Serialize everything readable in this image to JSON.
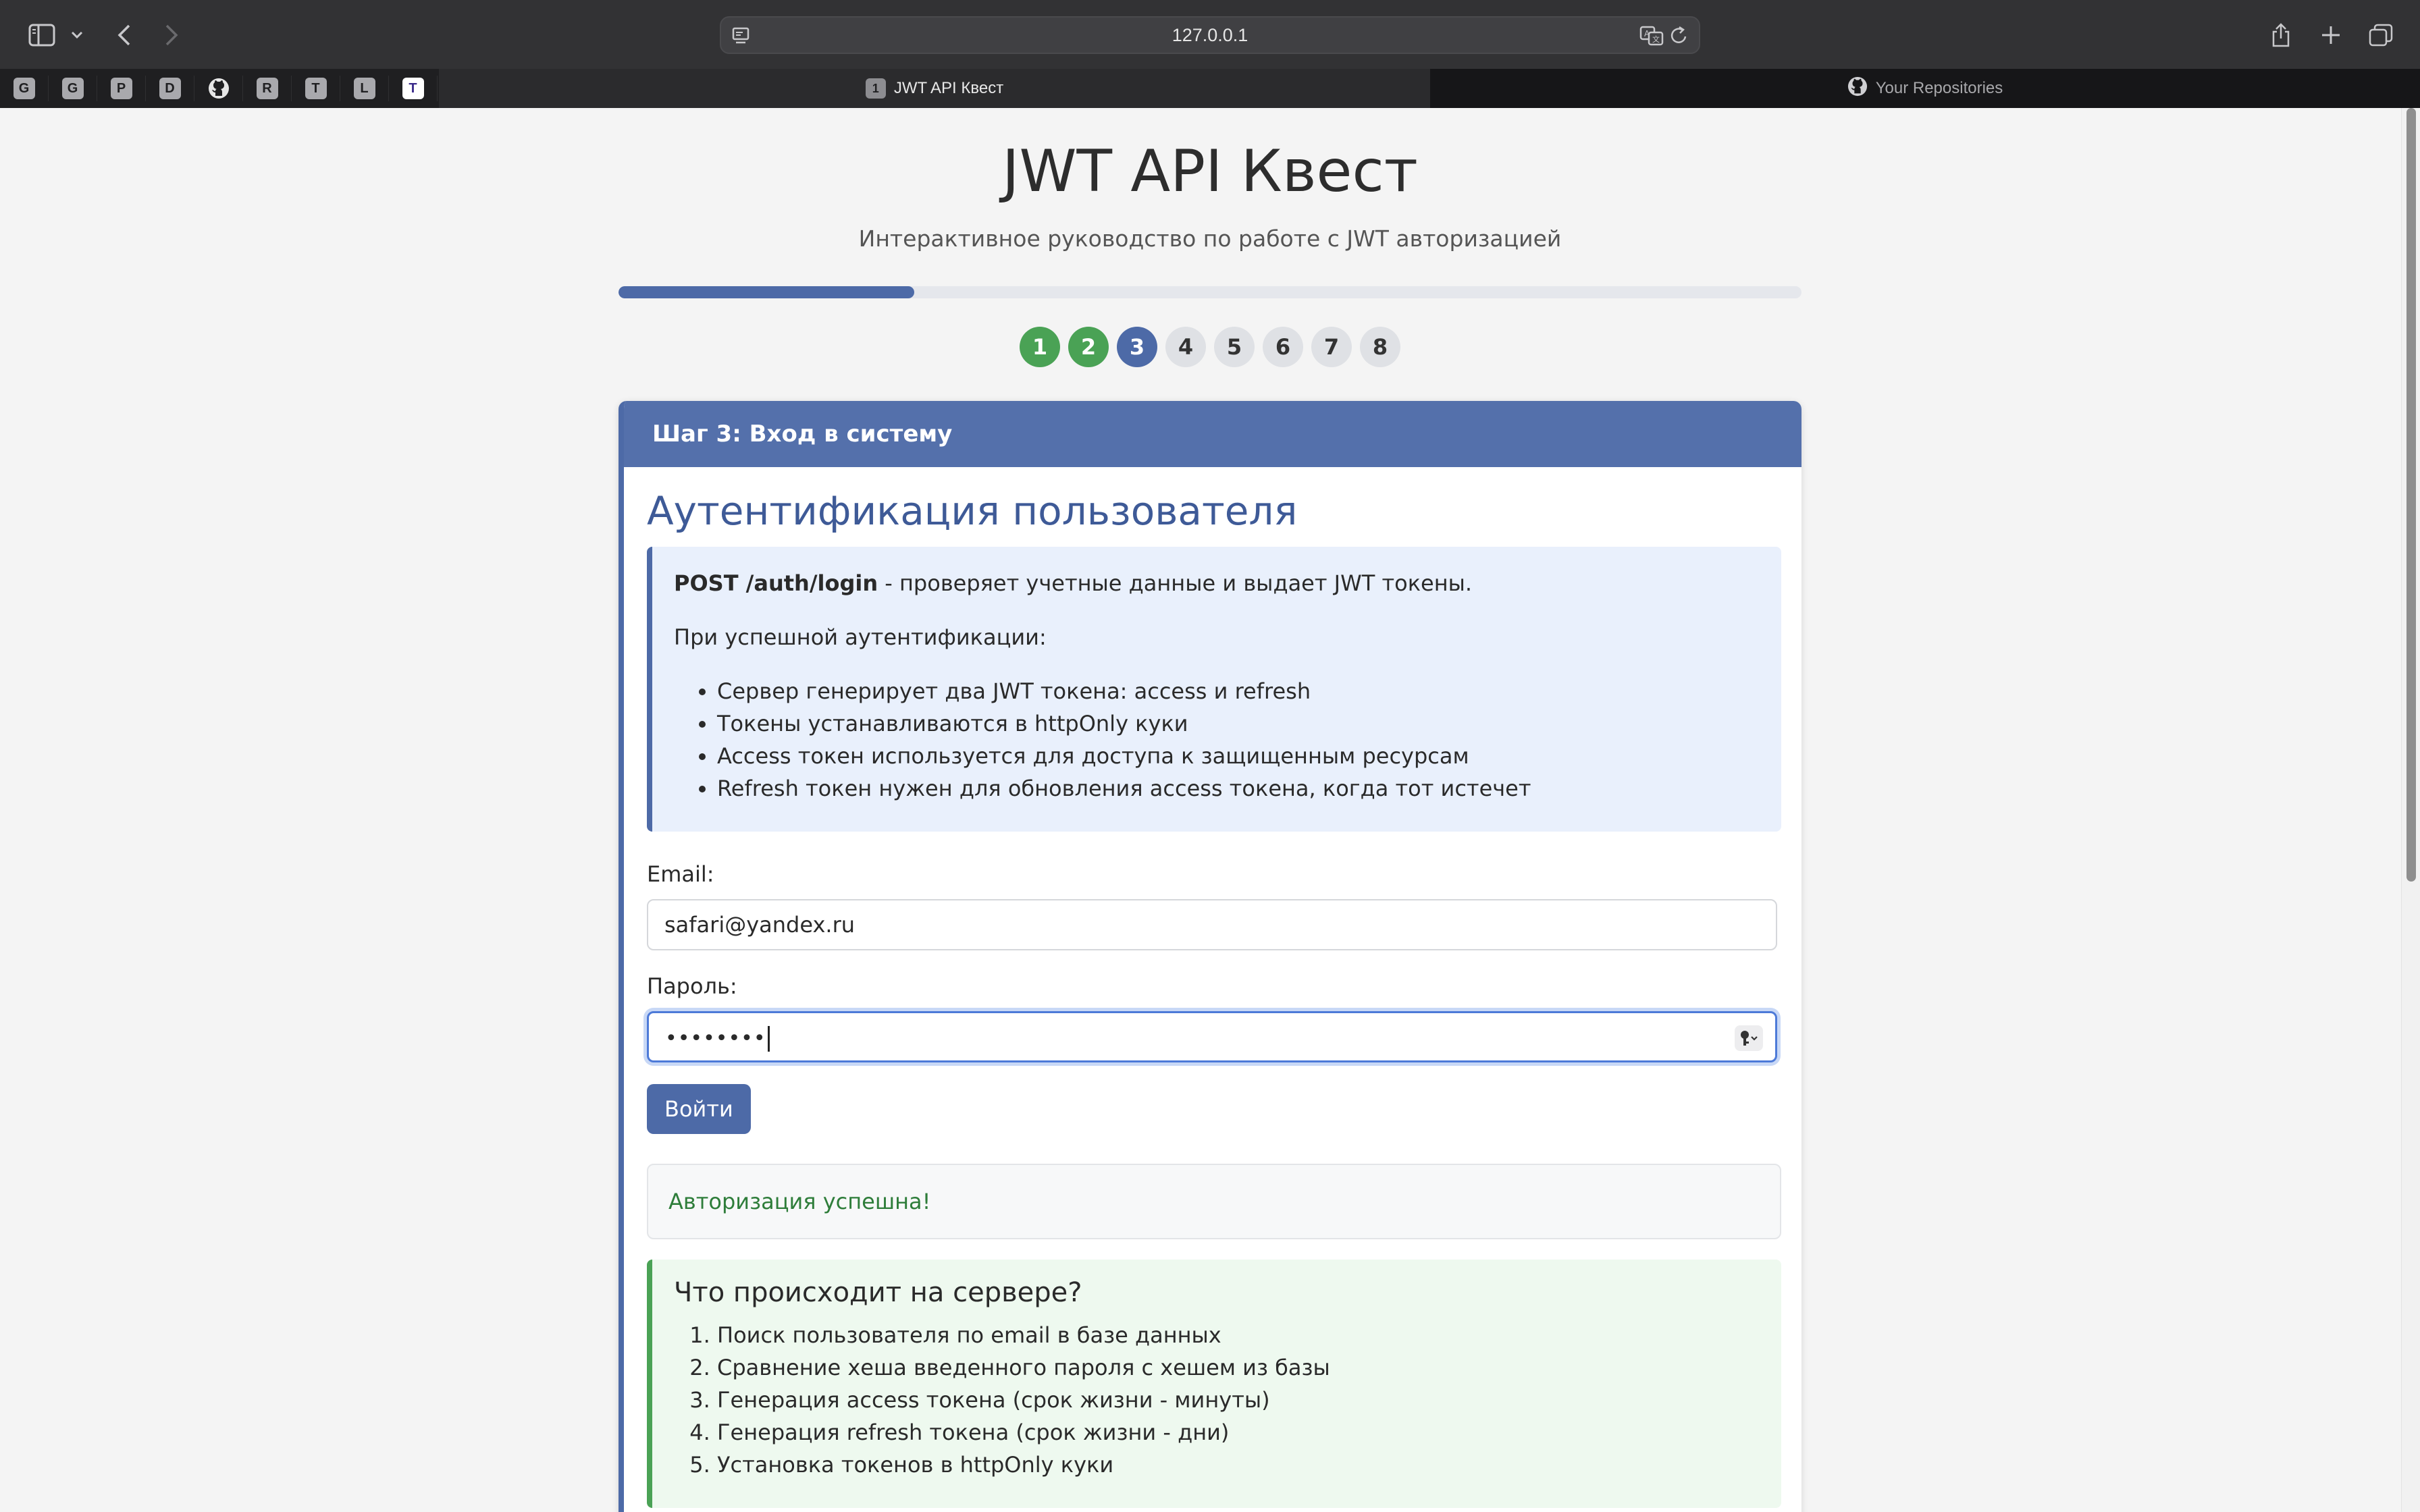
{
  "browser": {
    "url": "127.0.0.1",
    "pinned_tabs": [
      "G",
      "G",
      "P",
      "D",
      "github",
      "R",
      "T",
      "L",
      "T"
    ],
    "tabs": [
      {
        "label": "JWT API Квест",
        "favicon": "1",
        "active": true
      },
      {
        "label": "Your Repositories",
        "favicon": "github",
        "active": false
      }
    ]
  },
  "page": {
    "title": "JWT API Квест",
    "subtitle": "Интерактивное руководство по работе с JWT авторизацией",
    "progress_fraction": 0.25,
    "steps": [
      {
        "label": "1",
        "state": "done"
      },
      {
        "label": "2",
        "state": "done"
      },
      {
        "label": "3",
        "state": "current"
      },
      {
        "label": "4",
        "state": "todo"
      },
      {
        "label": "5",
        "state": "todo"
      },
      {
        "label": "6",
        "state": "todo"
      },
      {
        "label": "7",
        "state": "todo"
      },
      {
        "label": "8",
        "state": "todo"
      }
    ]
  },
  "card": {
    "header": "Шаг 3: Вход в систему",
    "heading": "Аутентификация пользователя",
    "info": {
      "endpoint": "POST /auth/login",
      "endpoint_desc": " - проверяет учетные данные и выдает JWT токены.",
      "intro": "При успешной аутентификации:",
      "items": [
        "Сервер генерирует два JWT токена: access и refresh",
        "Токены устанавливаются в httpOnly куки",
        "Access токен используется для доступа к защищенным ресурсам",
        "Refresh токен нужен для обновления access токена, когда тот истечет"
      ]
    },
    "form": {
      "email_label": "Email:",
      "email_value": "safari@yandex.ru",
      "password_label": "Пароль:",
      "password_value": "••••••••",
      "submit_label": "Войти"
    },
    "status": "Авторизация успешна!",
    "server": {
      "title": "Что происходит на сервере?",
      "steps": [
        "Поиск пользователя по email в базе данных",
        "Сравнение хеша введенного пароля с хешем из базы",
        "Генерация access токена (срок жизни - минуты)",
        "Генерация refresh токена (срок жизни - дни)",
        "Установка токенов в httpOnly куки"
      ]
    }
  },
  "colors": {
    "primary": "#4d6aa7",
    "success": "#4aa255",
    "success_text": "#2e7d3a"
  }
}
